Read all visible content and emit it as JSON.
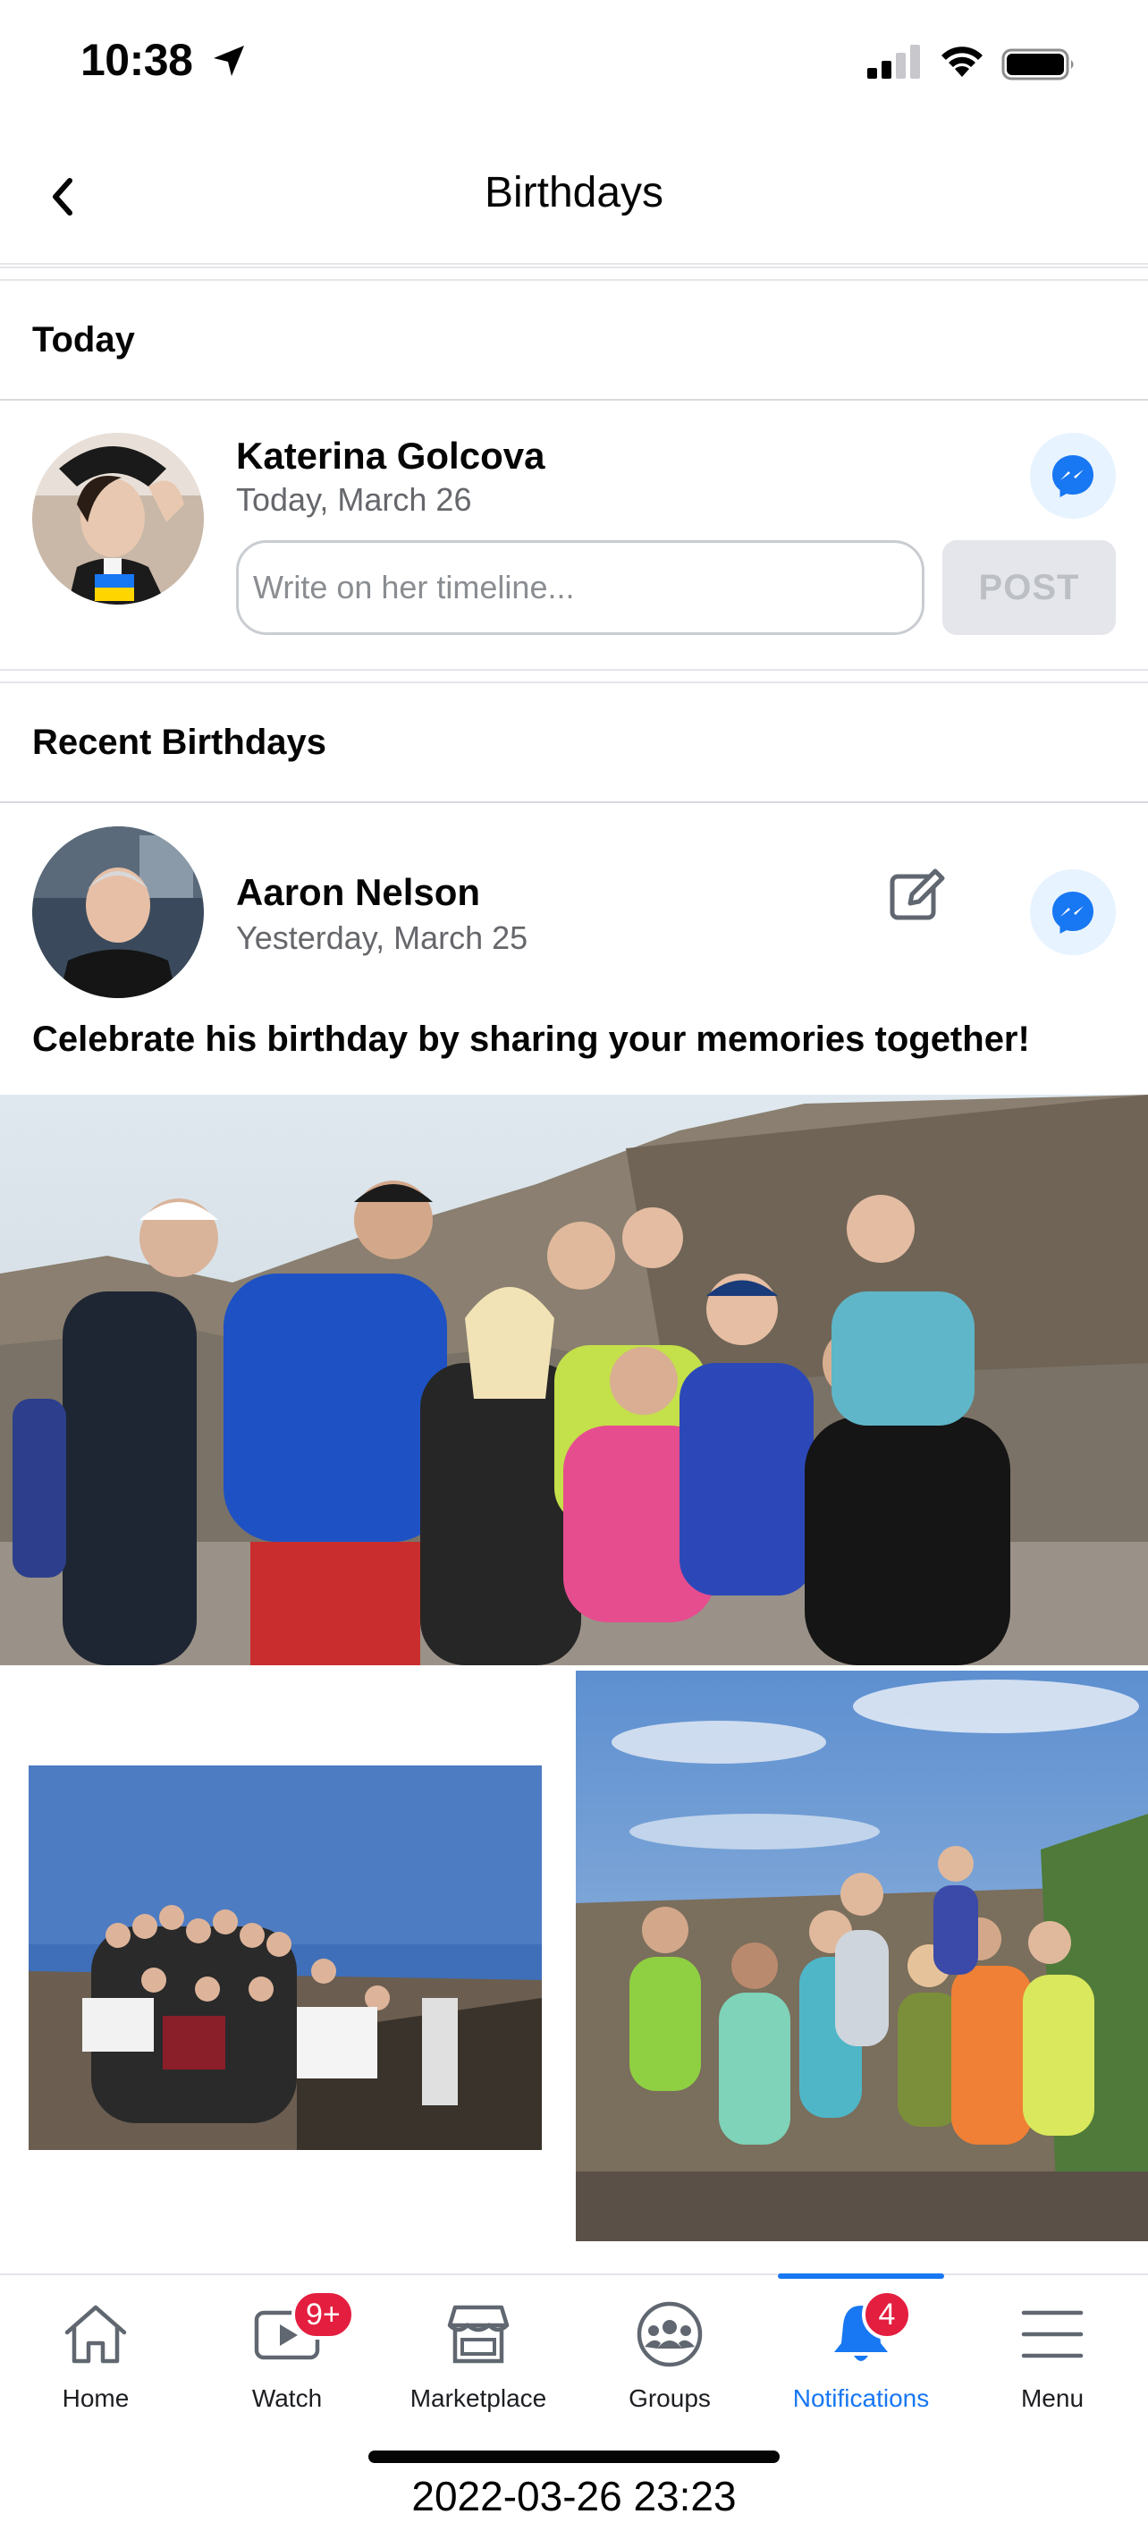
{
  "status_bar": {
    "time": "10:38",
    "icons": [
      "location-arrow-icon",
      "cellular-signal-icon",
      "wifi-icon",
      "battery-icon"
    ]
  },
  "header": {
    "title": "Birthdays",
    "back_icon": "chevron-left-icon"
  },
  "today_section": {
    "heading": "Today",
    "person": {
      "name": "Katerina Golcova",
      "date": "Today, March 26",
      "timeline_placeholder": "Write on her timeline...",
      "post_label": "POST"
    }
  },
  "recent_section": {
    "heading": "Recent Birthdays",
    "person": {
      "name": "Aaron Nelson",
      "date": "Yesterday, March 25",
      "prompt": "Celebrate his birthday by sharing your memories together!"
    }
  },
  "tabs": [
    {
      "label": "Home",
      "icon": "home-icon"
    },
    {
      "label": "Watch",
      "icon": "watch-icon",
      "badge": "9+"
    },
    {
      "label": "Marketplace",
      "icon": "marketplace-icon"
    },
    {
      "label": "Groups",
      "icon": "groups-icon"
    },
    {
      "label": "Notifications",
      "icon": "bell-icon",
      "badge": "4",
      "active": true
    },
    {
      "label": "Menu",
      "icon": "menu-icon"
    }
  ],
  "colors": {
    "accent": "#1877f2",
    "badge": "#e41e3f",
    "secondary_text": "#65676b"
  },
  "footer_timestamp": "2022-03-26 23:23"
}
